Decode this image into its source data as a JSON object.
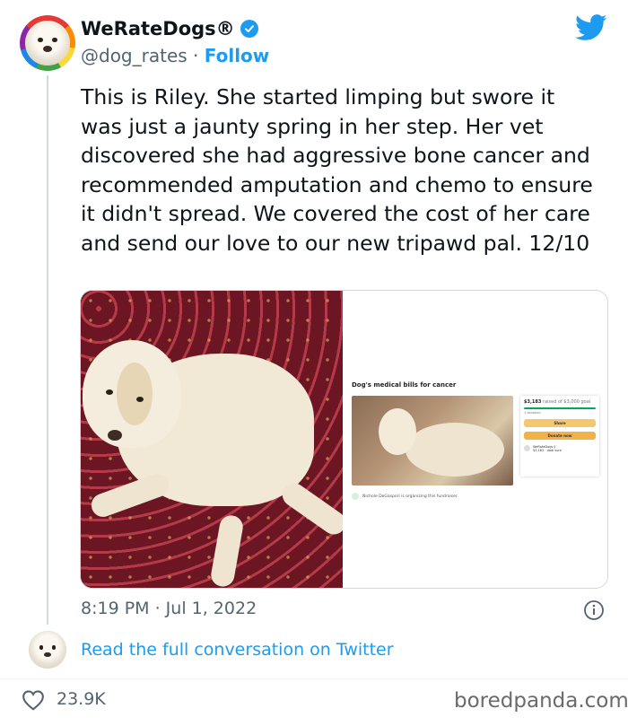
{
  "author": {
    "name": "WeRateDogs®",
    "handle": "@dog_rates",
    "separator": "·",
    "follow_label": "Follow"
  },
  "tweet": {
    "text": "This is Riley. She started limping but swore it was just a jaunty spring in her step. Her vet discovered she had aggressive bone cancer and recommended amputation and chemo to ensure it didn't spread. We covered the cost of her care and send our love to our new tripawd pal. 12/10",
    "timestamp": "8:19 PM · Jul 1, 2022"
  },
  "media": {
    "fundraiser_title": "Dog's medical bills for cancer",
    "amount": "$3,183",
    "amount_suffix": "raised of $3,000 goal",
    "progress": 1.0,
    "donations": "1 donation",
    "share_label": "Share",
    "donate_label": "Donate now",
    "donor_name": "WeRateDogs §",
    "donor_amount": "$3,183 · dadi sure",
    "organizer": "Nichole DeGaspori is organizing this fundraiser."
  },
  "footer": {
    "read_link": "Read the full conversation on Twitter",
    "likes": "23.9K"
  },
  "watermark": "boredpanda.com",
  "colors": {
    "accent": "#1d9bf0",
    "muted": "#536471",
    "text": "#0f1419"
  },
  "icons": {
    "verified": "verified-badge-icon",
    "bird": "twitter-bird-icon",
    "info": "info-icon",
    "heart": "heart-icon"
  }
}
